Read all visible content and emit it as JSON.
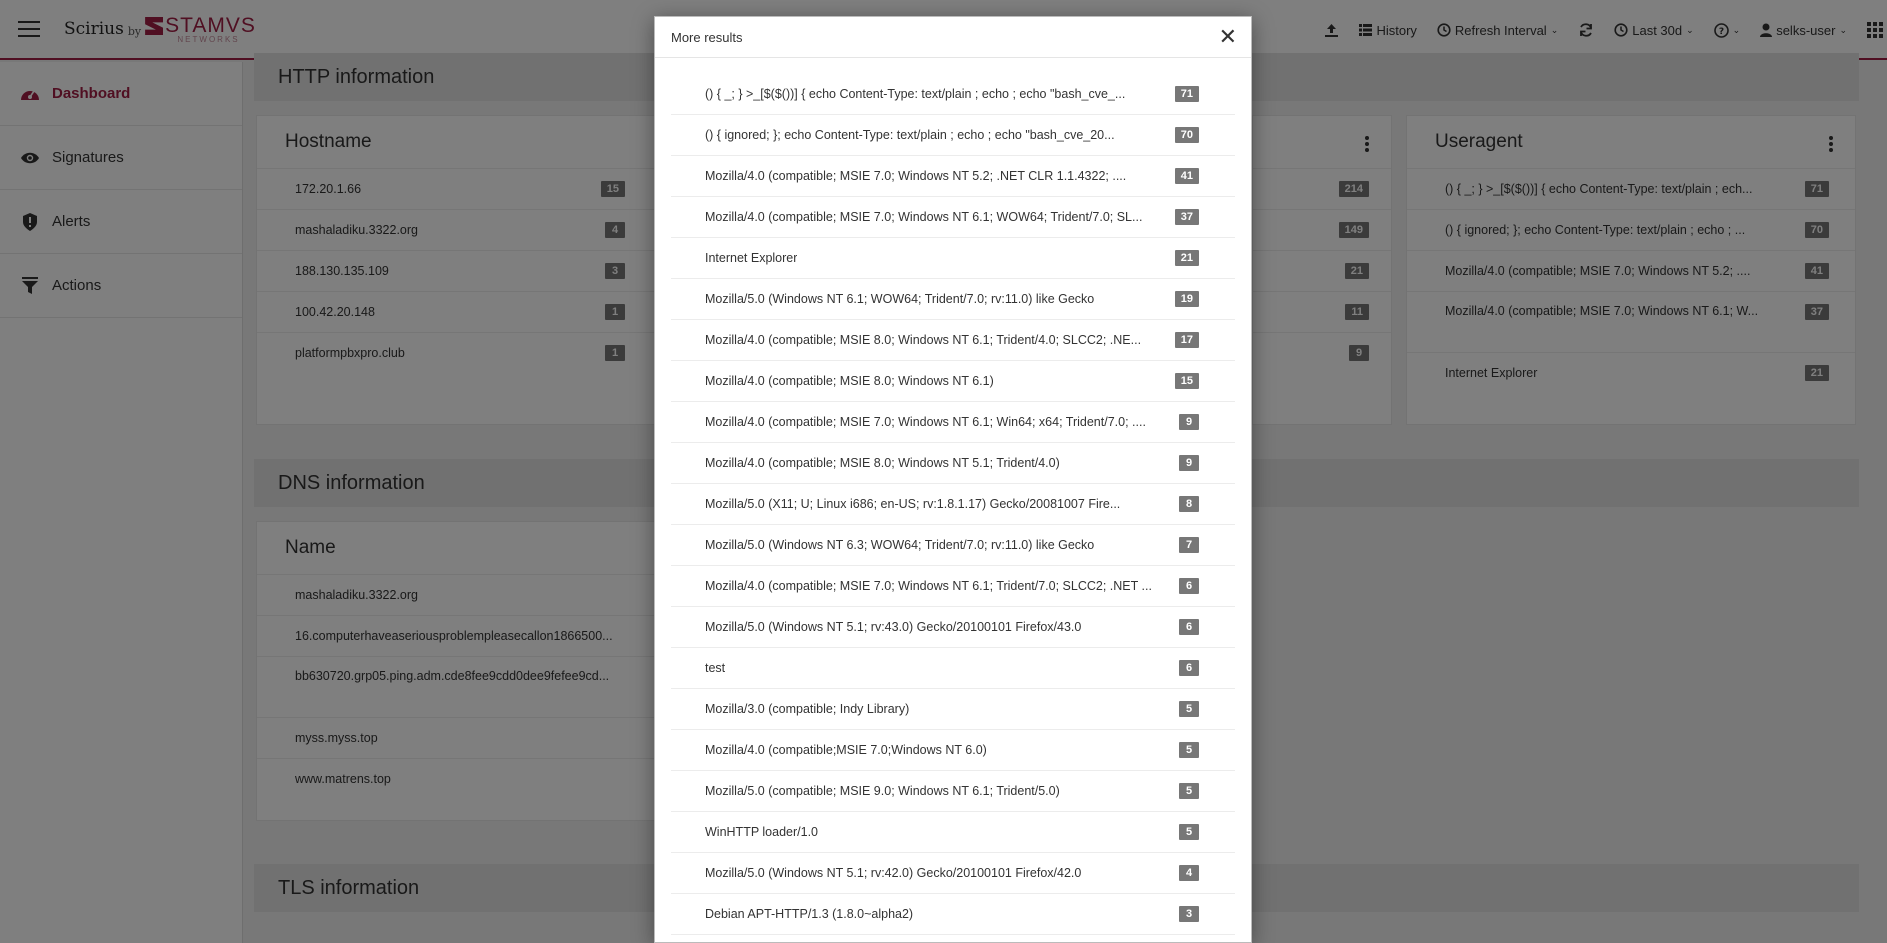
{
  "app": {
    "brand_name": "Scirius",
    "brand_by": "by",
    "logo_text": "STAMVS",
    "logo_sub": "NETWORKS"
  },
  "topbar": {
    "history": "History",
    "refresh": "Refresh Interval",
    "period": "Last 30d",
    "user": "selks-user"
  },
  "sidebar": {
    "items": [
      {
        "label": "Dashboard",
        "icon": "dashboard-icon",
        "active": true
      },
      {
        "label": "Signatures",
        "icon": "eye-icon"
      },
      {
        "label": "Alerts",
        "icon": "shield-alert-icon"
      },
      {
        "label": "Actions",
        "icon": "filter-icon"
      }
    ]
  },
  "http": {
    "title": "HTTP information",
    "hostname": {
      "title": "Hostname",
      "rows": [
        {
          "label": "172.20.1.66",
          "count": "15"
        },
        {
          "label": "mashaladiku.3322.org",
          "count": "4"
        },
        {
          "label": "188.130.135.109",
          "count": "3"
        },
        {
          "label": "100.42.20.148",
          "count": "1"
        },
        {
          "label": "platformpbxpro.club",
          "count": "1"
        }
      ]
    },
    "middle_counts": [
      "214",
      "149",
      "21",
      "11",
      "9"
    ],
    "useragent": {
      "title": "Useragent",
      "rows": [
        {
          "label": "() { _; } >_[$($())] { echo Content-Type: text/plain ; ech...",
          "count": "71"
        },
        {
          "label": "() { ignored; }; echo Content-Type: text/plain ; echo ; ...",
          "count": "70"
        },
        {
          "label": "Mozilla/4.0 (compatible; MSIE 7.0; Windows NT 5.2; ....",
          "count": "41"
        },
        {
          "label": "Mozilla/4.0 (compatible; MSIE 7.0; Windows NT 6.1; W...",
          "count": "37"
        },
        {
          "label": "Internet Explorer",
          "count": "21"
        }
      ]
    }
  },
  "dns": {
    "title": "DNS information",
    "name": {
      "title": "Name",
      "rows": [
        {
          "label": "mashaladiku.3322.org"
        },
        {
          "label": "16.computerhaveaseriousproblempleasecallon1866500..."
        },
        {
          "label": "bb630720.grp05.ping.adm.cde8fee9cdd0dee9fefee9cd..."
        },
        {
          "label": "myss.myss.top"
        },
        {
          "label": "www.matrens.top"
        }
      ]
    }
  },
  "tls": {
    "title": "TLS information"
  },
  "modal": {
    "title": "More results",
    "rows": [
      {
        "label": "() { _; } >_[$($())] { echo Content-Type: text/plain ; echo ; echo \"bash_cve_...",
        "count": "71"
      },
      {
        "label": "() { ignored; }; echo Content-Type: text/plain ; echo ; echo \"bash_cve_20...",
        "count": "70"
      },
      {
        "label": "Mozilla/4.0 (compatible; MSIE 7.0; Windows NT 5.2; .NET CLR 1.1.4322; ....",
        "count": "41"
      },
      {
        "label": "Mozilla/4.0 (compatible; MSIE 7.0; Windows NT 6.1; WOW64; Trident/7.0; SL...",
        "count": "37"
      },
      {
        "label": "Internet Explorer",
        "count": "21"
      },
      {
        "label": "Mozilla/5.0 (Windows NT 6.1; WOW64; Trident/7.0; rv:11.0) like Gecko",
        "count": "19"
      },
      {
        "label": "Mozilla/4.0 (compatible; MSIE 8.0; Windows NT 6.1; Trident/4.0; SLCC2; .NE...",
        "count": "17"
      },
      {
        "label": "Mozilla/4.0 (compatible; MSIE 8.0; Windows NT 6.1)",
        "count": "15"
      },
      {
        "label": "Mozilla/4.0 (compatible; MSIE 7.0; Windows NT 6.1; Win64; x64; Trident/7.0; ....",
        "count": "9"
      },
      {
        "label": "Mozilla/4.0 (compatible; MSIE 8.0; Windows NT 5.1; Trident/4.0)",
        "count": "9"
      },
      {
        "label": "Mozilla/5.0 (X11; U; Linux i686; en-US; rv:1.8.1.17) Gecko/20081007 Fire...",
        "count": "8"
      },
      {
        "label": "Mozilla/5.0 (Windows NT 6.3; WOW64; Trident/7.0; rv:11.0) like Gecko",
        "count": "7"
      },
      {
        "label": "Mozilla/4.0 (compatible; MSIE 7.0; Windows NT 6.1; Trident/7.0; SLCC2; .NET ...",
        "count": "6"
      },
      {
        "label": "Mozilla/5.0 (Windows NT 5.1; rv:43.0) Gecko/20100101 Firefox/43.0",
        "count": "6"
      },
      {
        "label": "test",
        "count": "6"
      },
      {
        "label": "Mozilla/3.0 (compatible; Indy Library)",
        "count": "5"
      },
      {
        "label": "Mozilla/4.0 (compatible;MSIE 7.0;Windows NT 6.0)",
        "count": "5"
      },
      {
        "label": "Mozilla/5.0 (compatible; MSIE 9.0; Windows NT 6.1; Trident/5.0)",
        "count": "5"
      },
      {
        "label": "WinHTTP loader/1.0",
        "count": "5"
      },
      {
        "label": "Mozilla/5.0 (Windows NT 5.1; rv:42.0) Gecko/20100101 Firefox/42.0",
        "count": "4"
      },
      {
        "label": "Debian APT-HTTP/1.3 (1.8.0~alpha2)",
        "count": "3"
      }
    ]
  },
  "colors": {
    "accent": "#a01f44",
    "badge": "#777777",
    "section_header": "#e3e3e3"
  }
}
